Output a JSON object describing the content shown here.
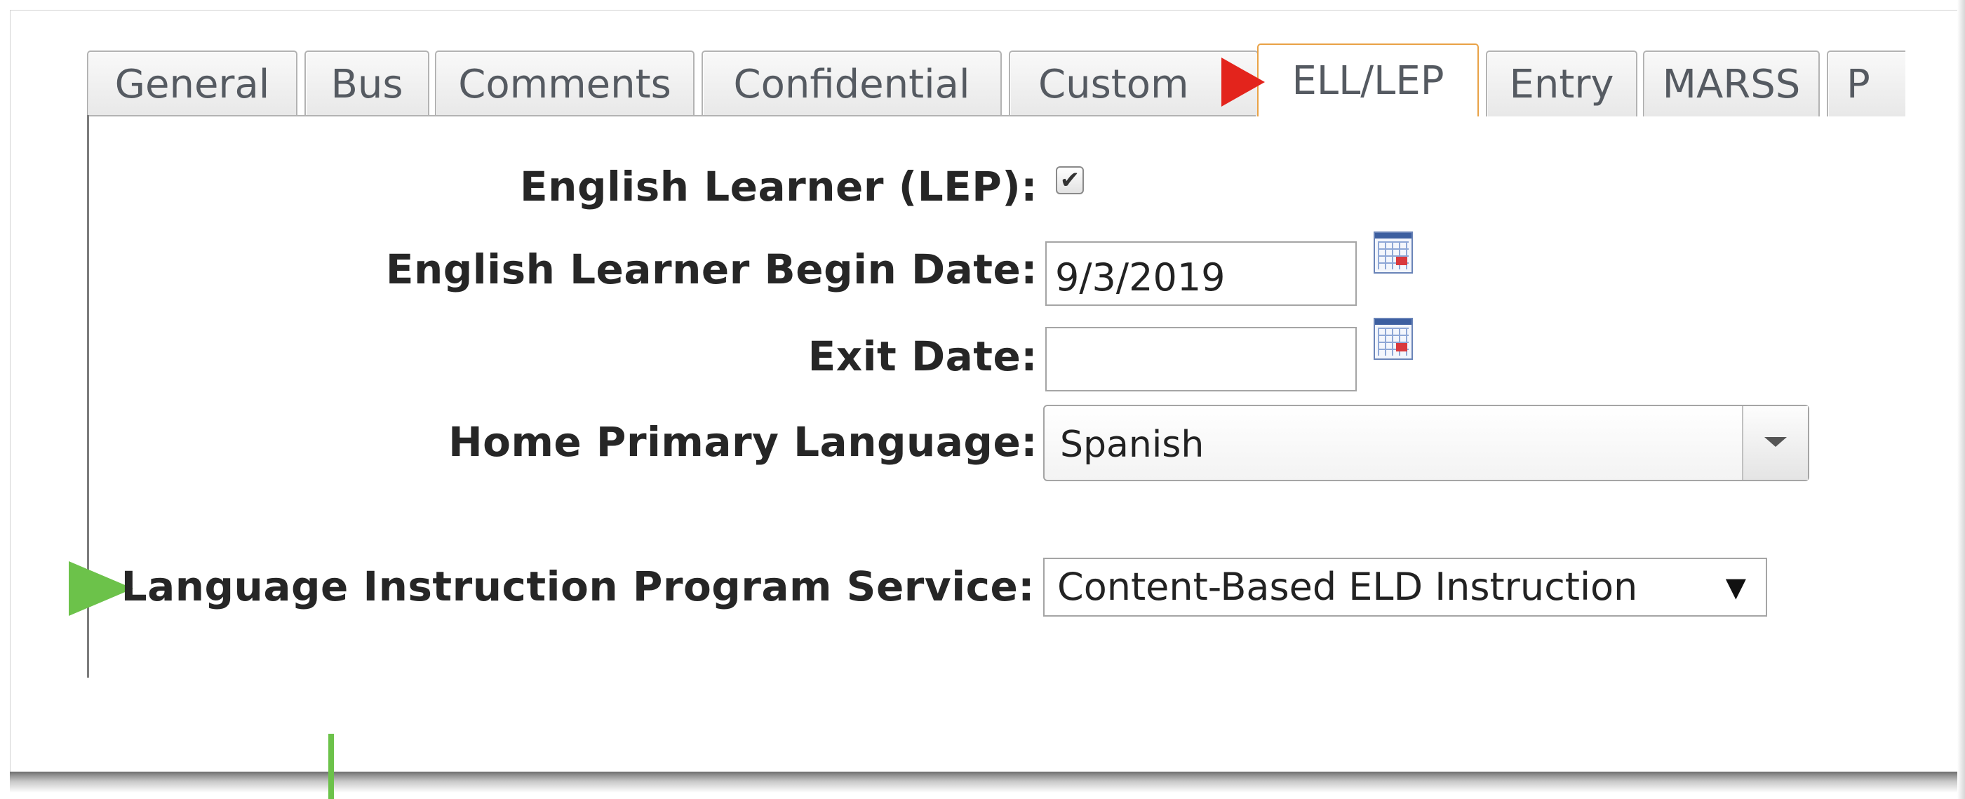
{
  "tabs": [
    {
      "label": "General",
      "active": false
    },
    {
      "label": "Bus",
      "active": false
    },
    {
      "label": "Comments",
      "active": false
    },
    {
      "label": "Confidential",
      "active": false
    },
    {
      "label": "Custom",
      "active": false
    },
    {
      "label": "ELL/LEP",
      "active": true
    },
    {
      "label": "Entry",
      "active": false
    },
    {
      "label": "MARSS",
      "active": false
    },
    {
      "label": "P",
      "active": false
    }
  ],
  "form": {
    "english_learner_label": "English Learner (LEP):",
    "english_learner_checked": true,
    "checkmark": "✔",
    "begin_date_label": "English Learner Begin Date:",
    "begin_date_value": "9/3/2019",
    "exit_date_label": "Exit Date:",
    "exit_date_value": "",
    "home_language_label": "Home Primary Language:",
    "home_language_value": "Spanish",
    "program_service_label": "Language Instruction Program Service:",
    "program_service_value": "Content-Based ELD Instruction",
    "program_service_arrow": "▼"
  },
  "annotations": {
    "tab_pointer_color": "#e3241c",
    "field_pointer_color": "#6cc24a"
  },
  "icons": [
    "calendar-icon",
    "dropdown-arrow-icon",
    "checkmark-icon"
  ]
}
